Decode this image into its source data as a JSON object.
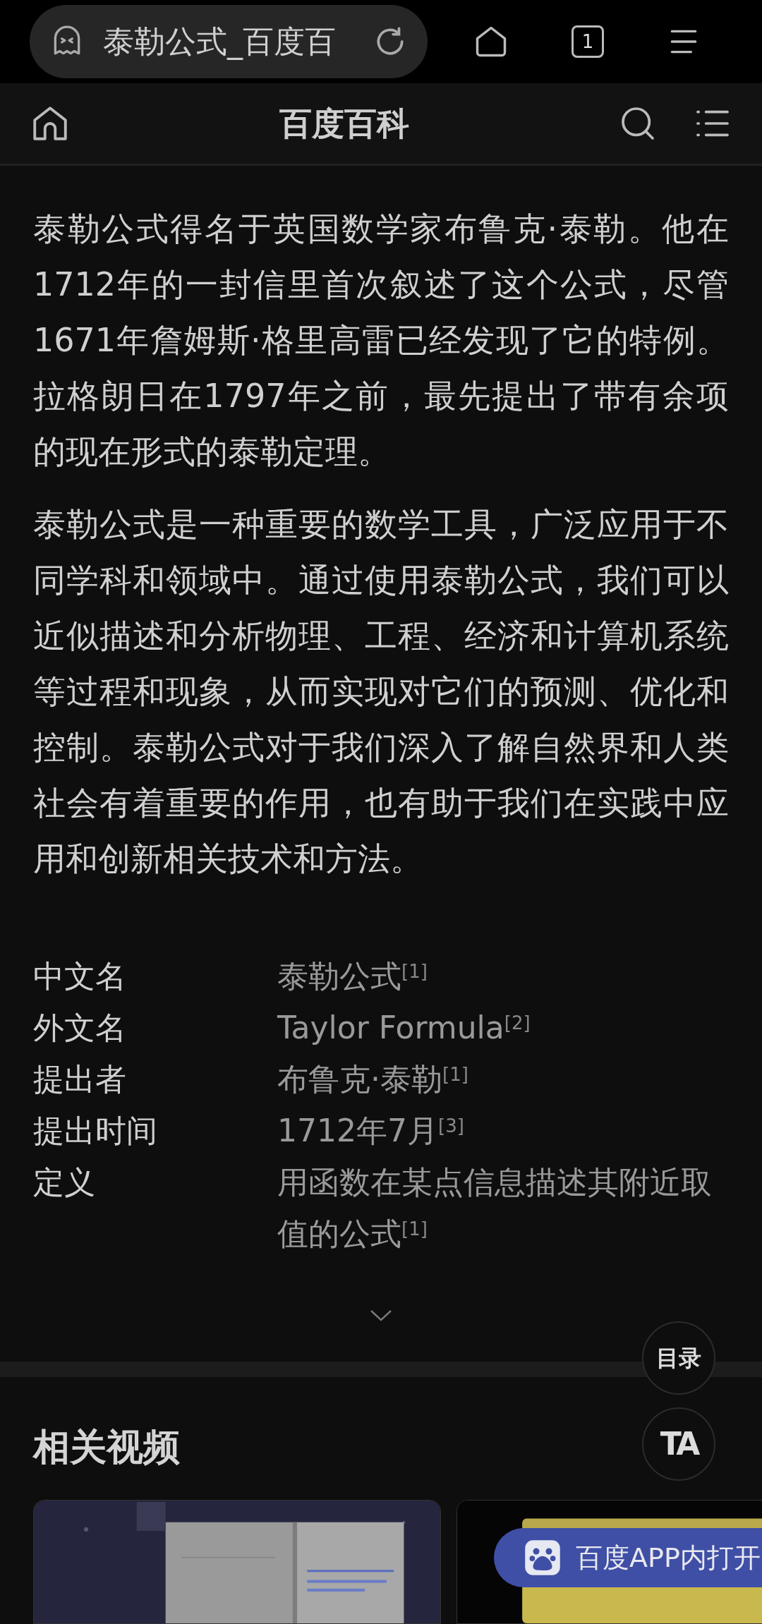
{
  "browser_bar": {
    "url_title": "泰勒公式_百度百",
    "tab_count": "1"
  },
  "header": {
    "title": "百度百科"
  },
  "paragraphs": [
    "泰勒公式得名于英国数学家布鲁克·泰勒。他在1712年的一封信里首次叙述了这个公式，尽管1671年詹姆斯·格里高雷已经发现了它的特例。拉格朗日在1797年之前，最先提出了带有余项的现在形式的泰勒定理。",
    "泰勒公式是一种重要的数学工具，广泛应用于不同学科和领域中。通过使用泰勒公式，我们可以近似描述和分析物理、工程、经济和计算机系统等过程和现象，从而实现对它们的预测、优化和控制。泰勒公式对于我们深入了解自然界和人类社会有着重要的作用，也有助于我们在实践中应用和创新相关技术和方法。"
  ],
  "info_table": [
    {
      "label": "中文名",
      "value": "泰勒公式$^{[1]}$"
    },
    {
      "label": "外文名",
      "value": "Taylor Formula$^{[2]}$"
    },
    {
      "label": "提出者",
      "value": "布鲁克·泰勒$^{[1]}$"
    },
    {
      "label": "提出时间",
      "value": "1712年7月$^{[3]}$"
    },
    {
      "label": "定义",
      "value": "用函数在某点信息描述其附近取值的公式$^{[1]}$"
    }
  ],
  "float_buttons": [
    "目录",
    "TA"
  ],
  "related_videos": {
    "title": "相关视频"
  },
  "open_app_button": {
    "label": "百度APP内打开"
  }
}
